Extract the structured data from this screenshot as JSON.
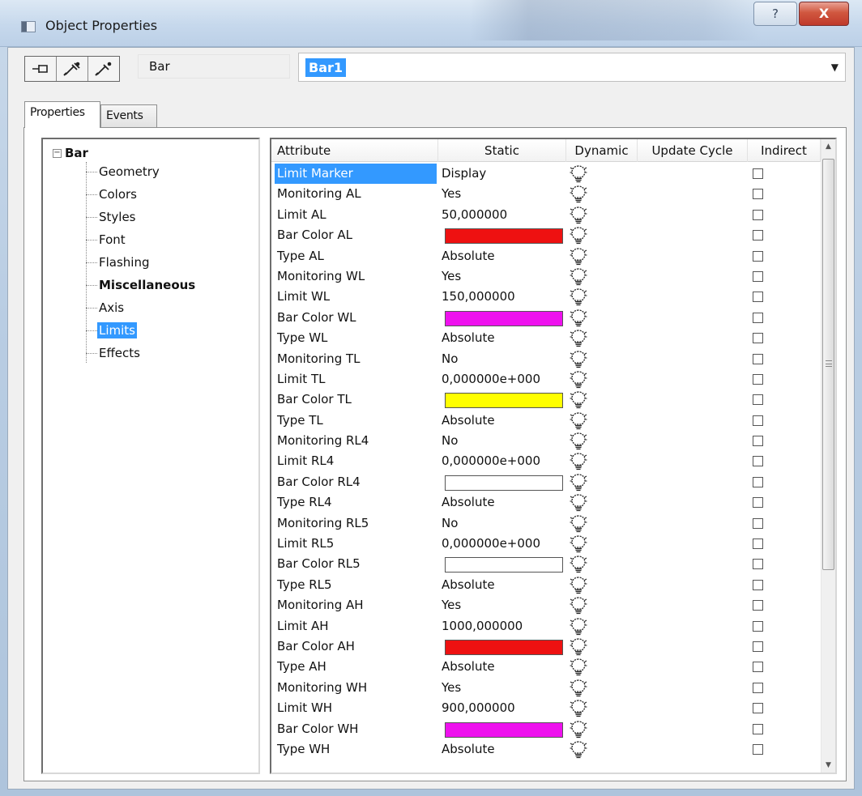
{
  "window": {
    "title": "Object Properties",
    "help_label": "?",
    "close_label": "X"
  },
  "toolbar": {
    "pin_icons": [
      "pin-icon",
      "pipette-icon",
      "pipette-icon"
    ],
    "object_type": "Bar",
    "object_name": "Bar1"
  },
  "tabs": [
    {
      "label": "Properties",
      "active": true
    },
    {
      "label": "Events",
      "active": false
    }
  ],
  "tree": {
    "root": "Bar",
    "items": [
      {
        "label": "Geometry",
        "bold": false,
        "selected": false
      },
      {
        "label": "Colors",
        "bold": false,
        "selected": false
      },
      {
        "label": "Styles",
        "bold": false,
        "selected": false
      },
      {
        "label": "Font",
        "bold": false,
        "selected": false
      },
      {
        "label": "Flashing",
        "bold": false,
        "selected": false
      },
      {
        "label": "Miscellaneous",
        "bold": true,
        "selected": false
      },
      {
        "label": "Axis",
        "bold": false,
        "selected": false
      },
      {
        "label": "Limits",
        "bold": false,
        "selected": true
      },
      {
        "label": "Effects",
        "bold": false,
        "selected": false
      }
    ]
  },
  "grid": {
    "columns": [
      "Attribute",
      "Static",
      "Dynamic",
      "Update Cycle",
      "Indirect"
    ],
    "rows": [
      {
        "attr": "Limit Marker",
        "static": "Display",
        "color": null,
        "selected": true
      },
      {
        "attr": "Monitoring AL",
        "static": "Yes",
        "color": null
      },
      {
        "attr": "Limit AL",
        "static": "50,000000",
        "color": null
      },
      {
        "attr": "Bar Color AL",
        "static": "",
        "color": "#ee1111"
      },
      {
        "attr": "Type AL",
        "static": "Absolute",
        "color": null
      },
      {
        "attr": "Monitoring WL",
        "static": "Yes",
        "color": null
      },
      {
        "attr": "Limit WL",
        "static": "150,000000",
        "color": null
      },
      {
        "attr": "Bar Color WL",
        "static": "",
        "color": "#ee11ee"
      },
      {
        "attr": "Type WL",
        "static": "Absolute",
        "color": null
      },
      {
        "attr": "Monitoring TL",
        "static": "No",
        "color": null
      },
      {
        "attr": "Limit TL",
        "static": "0,000000e+000",
        "color": null
      },
      {
        "attr": "Bar Color TL",
        "static": "",
        "color": "#ffff00"
      },
      {
        "attr": "Type TL",
        "static": "Absolute",
        "color": null
      },
      {
        "attr": "Monitoring RL4",
        "static": "No",
        "color": null
      },
      {
        "attr": "Limit RL4",
        "static": "0,000000e+000",
        "color": null
      },
      {
        "attr": "Bar Color RL4",
        "static": "",
        "color": "#ffffff"
      },
      {
        "attr": "Type RL4",
        "static": "Absolute",
        "color": null
      },
      {
        "attr": "Monitoring RL5",
        "static": "No",
        "color": null
      },
      {
        "attr": "Limit RL5",
        "static": "0,000000e+000",
        "color": null
      },
      {
        "attr": "Bar Color RL5",
        "static": "",
        "color": "#ffffff"
      },
      {
        "attr": "Type RL5",
        "static": "Absolute",
        "color": null
      },
      {
        "attr": "Monitoring AH",
        "static": "Yes",
        "color": null
      },
      {
        "attr": "Limit AH",
        "static": "1000,000000",
        "color": null
      },
      {
        "attr": "Bar Color AH",
        "static": "",
        "color": "#ee1111"
      },
      {
        "attr": "Type AH",
        "static": "Absolute",
        "color": null
      },
      {
        "attr": "Monitoring WH",
        "static": "Yes",
        "color": null
      },
      {
        "attr": "Limit WH",
        "static": "900,000000",
        "color": null
      },
      {
        "attr": "Bar Color WH",
        "static": "",
        "color": "#ee11ee"
      },
      {
        "attr": "Type WH",
        "static": "Absolute",
        "color": null
      }
    ],
    "dynamic_icon": "lightbulb-icon",
    "indirect_icon": "checkbox-icon"
  },
  "colors": {
    "selection": "#3399ff",
    "close_button": "#c0392b"
  }
}
